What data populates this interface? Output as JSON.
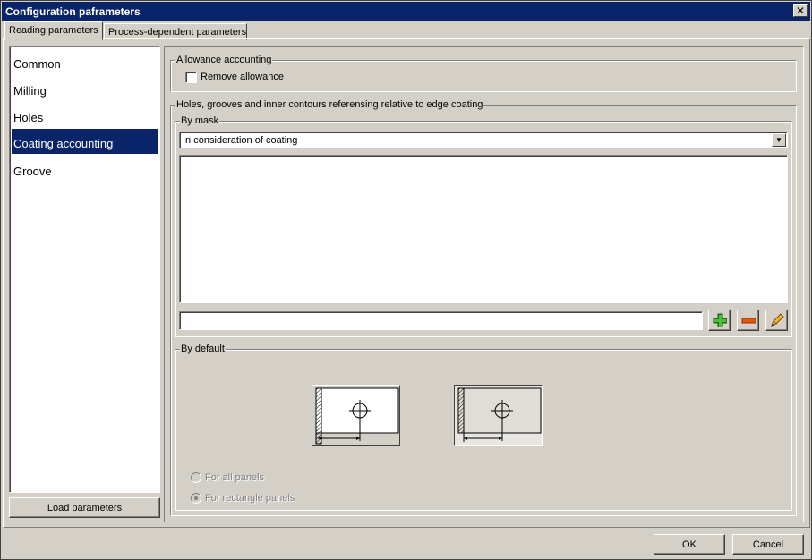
{
  "window": {
    "title": "Configuration paframeters",
    "close_symbol": "✕"
  },
  "tabs": [
    {
      "label": "Reading parameters",
      "active": true
    },
    {
      "label": "Process-dependent parameters",
      "active": false
    }
  ],
  "sidebar": {
    "items": [
      {
        "label": "Common",
        "selected": false
      },
      {
        "label": "Milling",
        "selected": false
      },
      {
        "label": "Holes",
        "selected": false
      },
      {
        "label": "Coating accounting",
        "selected": true
      },
      {
        "label": "Groove",
        "selected": false
      }
    ],
    "load_button": "Load parameters"
  },
  "allowance": {
    "group_label": "Allowance accounting",
    "remove_allowance_label": "Remove allowance",
    "remove_allowance_checked": false
  },
  "holes": {
    "group_label": "Holes, grooves and inner contours referensing relative to edge coating",
    "by_mask": {
      "group_label": "By mask",
      "combo_value": "In consideration of coating",
      "mask_list": [],
      "mask_input_value": "",
      "add_icon": "plus-icon",
      "remove_icon": "minus-icon",
      "edit_icon": "pencil-icon"
    },
    "by_default": {
      "group_label": "By default",
      "option_all_panels": "For all panels",
      "option_rectangle_panels": "For rectangle panels",
      "selected_option": "For rectangle panels"
    }
  },
  "footer": {
    "ok_label": "OK",
    "cancel_label": "Cancel"
  },
  "colors": {
    "titlebar": "#0a246a",
    "face": "#d4d0c8",
    "selection": "#0a246a"
  }
}
